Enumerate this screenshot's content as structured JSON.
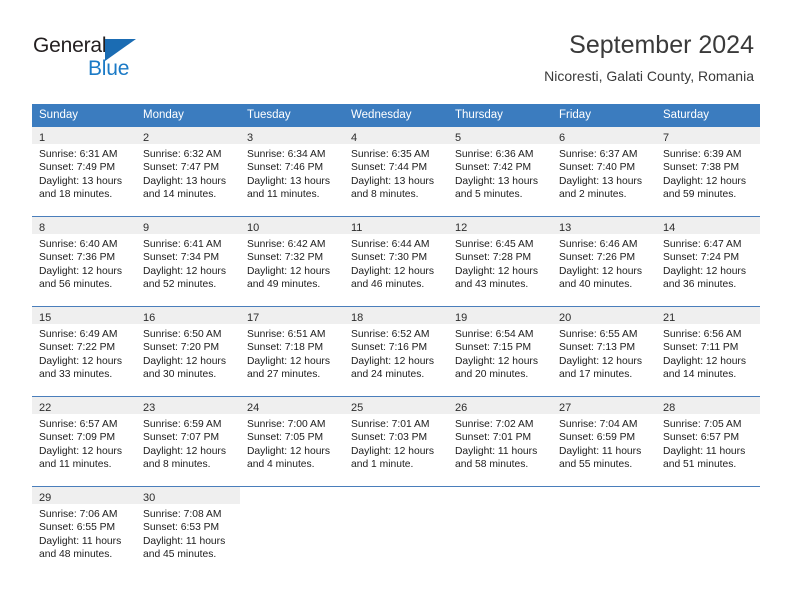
{
  "brand": {
    "name_part1": "General",
    "name_part2": "Blue",
    "accent_color": "#1b7ac6",
    "triangle_color": "#1b6cb3"
  },
  "header": {
    "title": "September 2024",
    "subtitle": "Nicoresti, Galati County, Romania"
  },
  "calendar": {
    "header_bg": "#3b7cbf",
    "day_strip_bg": "#efefef",
    "weekdays": [
      "Sunday",
      "Monday",
      "Tuesday",
      "Wednesday",
      "Thursday",
      "Friday",
      "Saturday"
    ],
    "weeks": [
      [
        {
          "day": "1",
          "sunrise": "Sunrise: 6:31 AM",
          "sunset": "Sunset: 7:49 PM",
          "daylight1": "Daylight: 13 hours",
          "daylight2": "and 18 minutes."
        },
        {
          "day": "2",
          "sunrise": "Sunrise: 6:32 AM",
          "sunset": "Sunset: 7:47 PM",
          "daylight1": "Daylight: 13 hours",
          "daylight2": "and 14 minutes."
        },
        {
          "day": "3",
          "sunrise": "Sunrise: 6:34 AM",
          "sunset": "Sunset: 7:46 PM",
          "daylight1": "Daylight: 13 hours",
          "daylight2": "and 11 minutes."
        },
        {
          "day": "4",
          "sunrise": "Sunrise: 6:35 AM",
          "sunset": "Sunset: 7:44 PM",
          "daylight1": "Daylight: 13 hours",
          "daylight2": "and 8 minutes."
        },
        {
          "day": "5",
          "sunrise": "Sunrise: 6:36 AM",
          "sunset": "Sunset: 7:42 PM",
          "daylight1": "Daylight: 13 hours",
          "daylight2": "and 5 minutes."
        },
        {
          "day": "6",
          "sunrise": "Sunrise: 6:37 AM",
          "sunset": "Sunset: 7:40 PM",
          "daylight1": "Daylight: 13 hours",
          "daylight2": "and 2 minutes."
        },
        {
          "day": "7",
          "sunrise": "Sunrise: 6:39 AM",
          "sunset": "Sunset: 7:38 PM",
          "daylight1": "Daylight: 12 hours",
          "daylight2": "and 59 minutes."
        }
      ],
      [
        {
          "day": "8",
          "sunrise": "Sunrise: 6:40 AM",
          "sunset": "Sunset: 7:36 PM",
          "daylight1": "Daylight: 12 hours",
          "daylight2": "and 56 minutes."
        },
        {
          "day": "9",
          "sunrise": "Sunrise: 6:41 AM",
          "sunset": "Sunset: 7:34 PM",
          "daylight1": "Daylight: 12 hours",
          "daylight2": "and 52 minutes."
        },
        {
          "day": "10",
          "sunrise": "Sunrise: 6:42 AM",
          "sunset": "Sunset: 7:32 PM",
          "daylight1": "Daylight: 12 hours",
          "daylight2": "and 49 minutes."
        },
        {
          "day": "11",
          "sunrise": "Sunrise: 6:44 AM",
          "sunset": "Sunset: 7:30 PM",
          "daylight1": "Daylight: 12 hours",
          "daylight2": "and 46 minutes."
        },
        {
          "day": "12",
          "sunrise": "Sunrise: 6:45 AM",
          "sunset": "Sunset: 7:28 PM",
          "daylight1": "Daylight: 12 hours",
          "daylight2": "and 43 minutes."
        },
        {
          "day": "13",
          "sunrise": "Sunrise: 6:46 AM",
          "sunset": "Sunset: 7:26 PM",
          "daylight1": "Daylight: 12 hours",
          "daylight2": "and 40 minutes."
        },
        {
          "day": "14",
          "sunrise": "Sunrise: 6:47 AM",
          "sunset": "Sunset: 7:24 PM",
          "daylight1": "Daylight: 12 hours",
          "daylight2": "and 36 minutes."
        }
      ],
      [
        {
          "day": "15",
          "sunrise": "Sunrise: 6:49 AM",
          "sunset": "Sunset: 7:22 PM",
          "daylight1": "Daylight: 12 hours",
          "daylight2": "and 33 minutes."
        },
        {
          "day": "16",
          "sunrise": "Sunrise: 6:50 AM",
          "sunset": "Sunset: 7:20 PM",
          "daylight1": "Daylight: 12 hours",
          "daylight2": "and 30 minutes."
        },
        {
          "day": "17",
          "sunrise": "Sunrise: 6:51 AM",
          "sunset": "Sunset: 7:18 PM",
          "daylight1": "Daylight: 12 hours",
          "daylight2": "and 27 minutes."
        },
        {
          "day": "18",
          "sunrise": "Sunrise: 6:52 AM",
          "sunset": "Sunset: 7:16 PM",
          "daylight1": "Daylight: 12 hours",
          "daylight2": "and 24 minutes."
        },
        {
          "day": "19",
          "sunrise": "Sunrise: 6:54 AM",
          "sunset": "Sunset: 7:15 PM",
          "daylight1": "Daylight: 12 hours",
          "daylight2": "and 20 minutes."
        },
        {
          "day": "20",
          "sunrise": "Sunrise: 6:55 AM",
          "sunset": "Sunset: 7:13 PM",
          "daylight1": "Daylight: 12 hours",
          "daylight2": "and 17 minutes."
        },
        {
          "day": "21",
          "sunrise": "Sunrise: 6:56 AM",
          "sunset": "Sunset: 7:11 PM",
          "daylight1": "Daylight: 12 hours",
          "daylight2": "and 14 minutes."
        }
      ],
      [
        {
          "day": "22",
          "sunrise": "Sunrise: 6:57 AM",
          "sunset": "Sunset: 7:09 PM",
          "daylight1": "Daylight: 12 hours",
          "daylight2": "and 11 minutes."
        },
        {
          "day": "23",
          "sunrise": "Sunrise: 6:59 AM",
          "sunset": "Sunset: 7:07 PM",
          "daylight1": "Daylight: 12 hours",
          "daylight2": "and 8 minutes."
        },
        {
          "day": "24",
          "sunrise": "Sunrise: 7:00 AM",
          "sunset": "Sunset: 7:05 PM",
          "daylight1": "Daylight: 12 hours",
          "daylight2": "and 4 minutes."
        },
        {
          "day": "25",
          "sunrise": "Sunrise: 7:01 AM",
          "sunset": "Sunset: 7:03 PM",
          "daylight1": "Daylight: 12 hours",
          "daylight2": "and 1 minute."
        },
        {
          "day": "26",
          "sunrise": "Sunrise: 7:02 AM",
          "sunset": "Sunset: 7:01 PM",
          "daylight1": "Daylight: 11 hours",
          "daylight2": "and 58 minutes."
        },
        {
          "day": "27",
          "sunrise": "Sunrise: 7:04 AM",
          "sunset": "Sunset: 6:59 PM",
          "daylight1": "Daylight: 11 hours",
          "daylight2": "and 55 minutes."
        },
        {
          "day": "28",
          "sunrise": "Sunrise: 7:05 AM",
          "sunset": "Sunset: 6:57 PM",
          "daylight1": "Daylight: 11 hours",
          "daylight2": "and 51 minutes."
        }
      ],
      [
        {
          "day": "29",
          "sunrise": "Sunrise: 7:06 AM",
          "sunset": "Sunset: 6:55 PM",
          "daylight1": "Daylight: 11 hours",
          "daylight2": "and 48 minutes."
        },
        {
          "day": "30",
          "sunrise": "Sunrise: 7:08 AM",
          "sunset": "Sunset: 6:53 PM",
          "daylight1": "Daylight: 11 hours",
          "daylight2": "and 45 minutes."
        },
        {
          "day": "",
          "sunrise": "",
          "sunset": "",
          "daylight1": "",
          "daylight2": ""
        },
        {
          "day": "",
          "sunrise": "",
          "sunset": "",
          "daylight1": "",
          "daylight2": ""
        },
        {
          "day": "",
          "sunrise": "",
          "sunset": "",
          "daylight1": "",
          "daylight2": ""
        },
        {
          "day": "",
          "sunrise": "",
          "sunset": "",
          "daylight1": "",
          "daylight2": ""
        },
        {
          "day": "",
          "sunrise": "",
          "sunset": "",
          "daylight1": "",
          "daylight2": ""
        }
      ]
    ]
  }
}
